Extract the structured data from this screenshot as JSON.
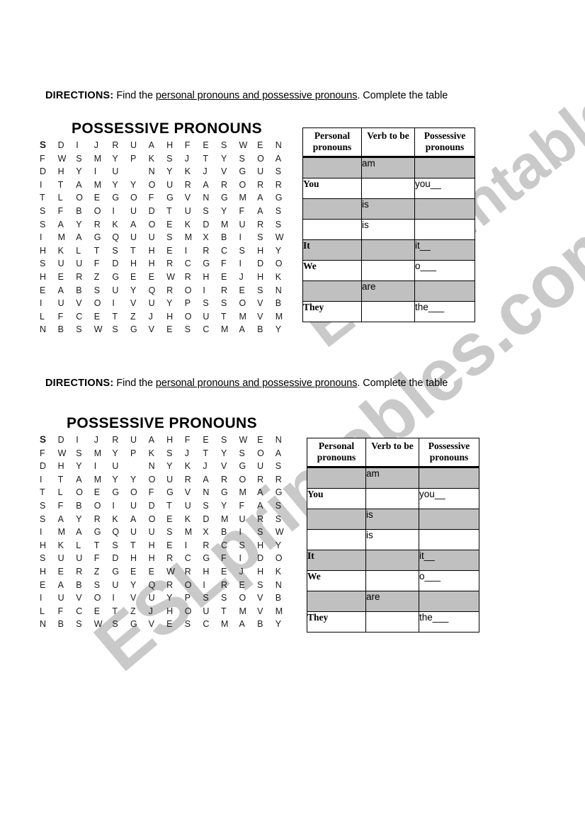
{
  "watermark": {
    "text": "ESLprintables.com"
  },
  "sections": [
    {
      "directions": {
        "label": "DIRECTIONS:",
        "part1": " Find the ",
        "underlined": "personal pronouns and possessive pronouns",
        "part2": ". Complete the table"
      },
      "title": "POSSESSIVE PRONOUNS",
      "grid": {
        "columns": 14,
        "rows": 15,
        "letters": [
          [
            "S",
            "D",
            "I",
            "J",
            "R",
            "U",
            "A",
            "H",
            "F",
            "E",
            "S",
            "W",
            "E",
            "N"
          ],
          [
            "F",
            "W",
            "S",
            "M",
            "Y",
            "P",
            "K",
            "S",
            "J",
            "T",
            "Y",
            "S",
            "O",
            "A"
          ],
          [
            "D",
            "H",
            "Y",
            "I",
            "U",
            "",
            "N",
            "Y",
            "K",
            "J",
            "V",
            "G",
            "U",
            "S"
          ],
          [
            "I",
            "T",
            "A",
            "M",
            "Y",
            "Y",
            "O",
            "U",
            "R",
            "A",
            "R",
            "O",
            "R",
            "R"
          ],
          [
            "T",
            "L",
            "O",
            "E",
            "G",
            "O",
            "F",
            "G",
            "V",
            "N",
            "G",
            "M",
            "A",
            "G"
          ],
          [
            "S",
            "F",
            "B",
            "O",
            "I",
            "U",
            "D",
            "T",
            "U",
            "S",
            "Y",
            "F",
            "A",
            "S"
          ],
          [
            "S",
            "A",
            "Y",
            "R",
            "K",
            "A",
            "O",
            "E",
            "K",
            "D",
            "M",
            "U",
            "R",
            "S"
          ],
          [
            "I",
            "M",
            "A",
            "G",
            "Q",
            "U",
            "U",
            "S",
            "M",
            "X",
            "B",
            "I",
            "S",
            "W"
          ],
          [
            "H",
            "K",
            "L",
            "T",
            "S",
            "T",
            "H",
            "E",
            "I",
            "R",
            "C",
            "S",
            "H",
            "Y"
          ],
          [
            "S",
            "U",
            "U",
            "F",
            "D",
            "H",
            "H",
            "R",
            "C",
            "G",
            "F",
            "I",
            "D",
            "O"
          ],
          [
            "H",
            "E",
            "R",
            "Z",
            "G",
            "E",
            "E",
            "W",
            "R",
            "H",
            "E",
            "J",
            "H",
            "K"
          ],
          [
            "E",
            "A",
            "B",
            "S",
            "U",
            "Y",
            "Q",
            "R",
            "O",
            "I",
            "R",
            "E",
            "S",
            "N"
          ],
          [
            "I",
            "U",
            "V",
            "O",
            "I",
            "V",
            "U",
            "Y",
            "P",
            "S",
            "S",
            "O",
            "V",
            "B"
          ],
          [
            "L",
            "F",
            "C",
            "E",
            "T",
            "Z",
            "J",
            "H",
            "O",
            "U",
            "T",
            "M",
            "V",
            "M"
          ],
          [
            "N",
            "B",
            "S",
            "W",
            "S",
            "G",
            "V",
            "E",
            "S",
            "C",
            "M",
            "A",
            "B",
            "Y"
          ]
        ]
      },
      "table": {
        "headers": [
          "Personal pronouns",
          "Verb to be",
          "Possessive pronouns"
        ],
        "rows": [
          {
            "shaded": true,
            "personal": "",
            "verb": "am",
            "possessive": ""
          },
          {
            "shaded": false,
            "personal": "You",
            "verb": "",
            "possessive": "you__"
          },
          {
            "shaded": true,
            "personal": "",
            "verb": "is",
            "possessive": ""
          },
          {
            "shaded": false,
            "personal": "",
            "verb": "is",
            "possessive": ""
          },
          {
            "shaded": true,
            "personal": "It",
            "verb": "",
            "possessive": "it__"
          },
          {
            "shaded": false,
            "personal": "We",
            "verb": "",
            "possessive": "o___"
          },
          {
            "shaded": true,
            "personal": "",
            "verb": "are",
            "possessive": ""
          },
          {
            "shaded": false,
            "personal": "They",
            "verb": "",
            "possessive": "the___"
          }
        ]
      }
    },
    {
      "directions": {
        "label": "DIRECTIONS:",
        "part1": " Find the ",
        "underlined": "personal pronouns and possessive pronouns",
        "part2": ". Complete the table"
      },
      "title": "POSSESSIVE PRONOUNS",
      "grid": {
        "columns": 14,
        "rows": 15,
        "letters": [
          [
            "S",
            "D",
            "I",
            "J",
            "R",
            "U",
            "A",
            "H",
            "F",
            "E",
            "S",
            "W",
            "E",
            "N"
          ],
          [
            "F",
            "W",
            "S",
            "M",
            "Y",
            "P",
            "K",
            "S",
            "J",
            "T",
            "Y",
            "S",
            "O",
            "A"
          ],
          [
            "D",
            "H",
            "Y",
            "I",
            "U",
            "",
            "N",
            "Y",
            "K",
            "J",
            "V",
            "G",
            "U",
            "S"
          ],
          [
            "I",
            "T",
            "A",
            "M",
            "Y",
            "Y",
            "O",
            "U",
            "R",
            "A",
            "R",
            "O",
            "R",
            "R"
          ],
          [
            "T",
            "L",
            "O",
            "E",
            "G",
            "O",
            "F",
            "G",
            "V",
            "N",
            "G",
            "M",
            "A",
            "G"
          ],
          [
            "S",
            "F",
            "B",
            "O",
            "I",
            "U",
            "D",
            "T",
            "U",
            "S",
            "Y",
            "F",
            "A",
            "S"
          ],
          [
            "S",
            "A",
            "Y",
            "R",
            "K",
            "A",
            "O",
            "E",
            "K",
            "D",
            "M",
            "U",
            "R",
            "S"
          ],
          [
            "I",
            "M",
            "A",
            "G",
            "Q",
            "U",
            "U",
            "S",
            "M",
            "X",
            "B",
            "I",
            "S",
            "W"
          ],
          [
            "H",
            "K",
            "L",
            "T",
            "S",
            "T",
            "H",
            "E",
            "I",
            "R",
            "C",
            "S",
            "H",
            "Y"
          ],
          [
            "S",
            "U",
            "U",
            "F",
            "D",
            "H",
            "H",
            "R",
            "C",
            "G",
            "F",
            "I",
            "D",
            "O"
          ],
          [
            "H",
            "E",
            "R",
            "Z",
            "G",
            "E",
            "E",
            "W",
            "R",
            "H",
            "E",
            "J",
            "H",
            "K"
          ],
          [
            "E",
            "A",
            "B",
            "S",
            "U",
            "Y",
            "Q",
            "R",
            "O",
            "I",
            "R",
            "E",
            "S",
            "N"
          ],
          [
            "I",
            "U",
            "V",
            "O",
            "I",
            "V",
            "U",
            "Y",
            "P",
            "S",
            "S",
            "O",
            "V",
            "B"
          ],
          [
            "L",
            "F",
            "C",
            "E",
            "T",
            "Z",
            "J",
            "H",
            "O",
            "U",
            "T",
            "M",
            "V",
            "M"
          ],
          [
            "N",
            "B",
            "S",
            "W",
            "S",
            "G",
            "V",
            "E",
            "S",
            "C",
            "M",
            "A",
            "B",
            "Y"
          ]
        ]
      },
      "table": {
        "headers": [
          "Personal pronouns",
          "Verb to be",
          "Possessive pronouns"
        ],
        "rows": [
          {
            "shaded": true,
            "personal": "",
            "verb": "am",
            "possessive": ""
          },
          {
            "shaded": false,
            "personal": "You",
            "verb": "",
            "possessive": "you__"
          },
          {
            "shaded": true,
            "personal": "",
            "verb": "is",
            "possessive": ""
          },
          {
            "shaded": false,
            "personal": "",
            "verb": "is",
            "possessive": ""
          },
          {
            "shaded": true,
            "personal": "It",
            "verb": "",
            "possessive": "it__"
          },
          {
            "shaded": false,
            "personal": "We",
            "verb": "",
            "possessive": "o___"
          },
          {
            "shaded": true,
            "personal": "",
            "verb": "are",
            "possessive": ""
          },
          {
            "shaded": false,
            "personal": "They",
            "verb": "",
            "possessive": "the___"
          }
        ]
      }
    }
  ]
}
